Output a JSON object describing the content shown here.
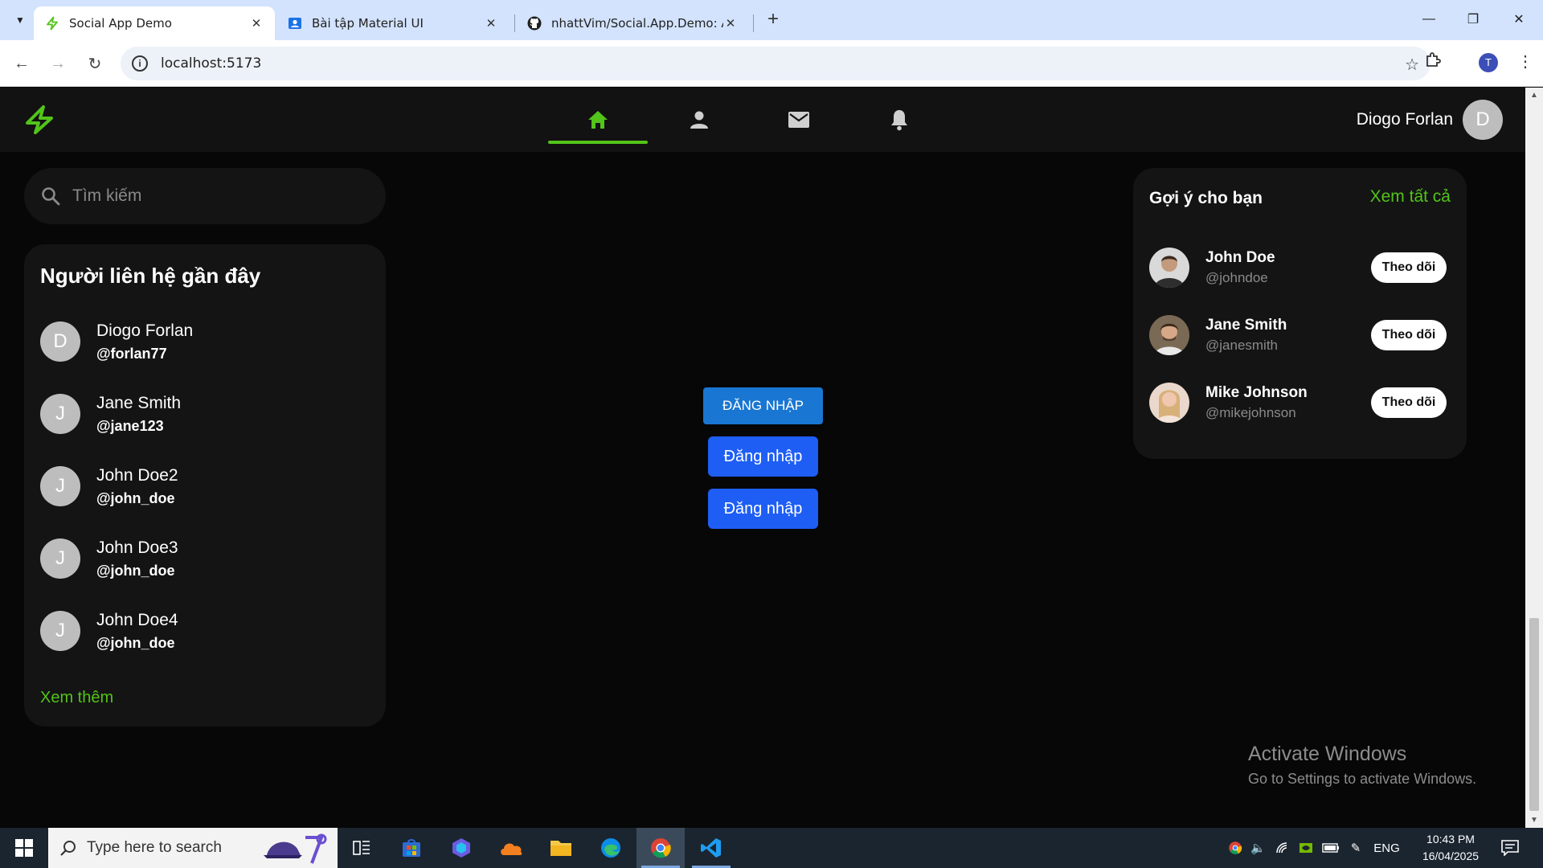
{
  "browser": {
    "tabs": [
      {
        "title": "Social App Demo",
        "active": true
      },
      {
        "title": "Bài tập Material UI",
        "active": false
      },
      {
        "title": "nhattVim/Social.App.Demo: A s",
        "active": false
      }
    ],
    "new_tab_label": "+",
    "url": "localhost:5173",
    "profile_initial": "T"
  },
  "app": {
    "accent_color": "#52c41a",
    "nav_icons": [
      "home-icon",
      "person-icon",
      "mail-icon",
      "bell-icon"
    ],
    "user": {
      "name": "Diogo Forlan",
      "initial": "D"
    },
    "search": {
      "placeholder": "Tìm kiếm"
    },
    "contacts": {
      "title": "Người liên hệ gần đây",
      "items": [
        {
          "initial": "D",
          "name": "Diogo Forlan",
          "handle": "@forlan77"
        },
        {
          "initial": "J",
          "name": "Jane Smith",
          "handle": "@jane123"
        },
        {
          "initial": "J",
          "name": "John Doe2",
          "handle": "@john_doe"
        },
        {
          "initial": "J",
          "name": "John Doe3",
          "handle": "@john_doe"
        },
        {
          "initial": "J",
          "name": "John Doe4",
          "handle": "@john_doe"
        }
      ],
      "more_label": "Xem thêm"
    },
    "login_buttons": [
      "ĐĂNG NHẬP",
      "Đăng nhập",
      "Đăng nhập"
    ],
    "suggestions": {
      "title": "Gợi ý cho bạn",
      "see_all": "Xem tất cả",
      "follow_label": "Theo dõi",
      "items": [
        {
          "name": "John Doe",
          "handle": "@johndoe"
        },
        {
          "name": "Jane Smith",
          "handle": "@janesmith"
        },
        {
          "name": "Mike Johnson",
          "handle": "@mikejohnson"
        }
      ]
    }
  },
  "watermark": {
    "line1": "Activate Windows",
    "line2": "Go to Settings to activate Windows."
  },
  "taskbar": {
    "search_placeholder": "Type here to search",
    "language": "ENG",
    "time": "10:43 PM",
    "date": "16/04/2025"
  }
}
